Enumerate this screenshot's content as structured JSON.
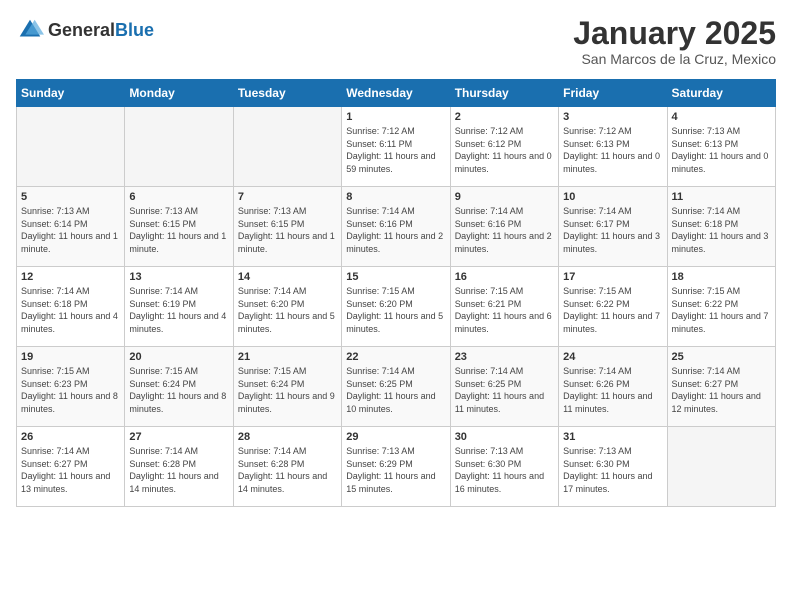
{
  "logo": {
    "general": "General",
    "blue": "Blue"
  },
  "header": {
    "month": "January 2025",
    "location": "San Marcos de la Cruz, Mexico"
  },
  "weekdays": [
    "Sunday",
    "Monday",
    "Tuesday",
    "Wednesday",
    "Thursday",
    "Friday",
    "Saturday"
  ],
  "weeks": [
    [
      {
        "day": "",
        "empty": true
      },
      {
        "day": "",
        "empty": true
      },
      {
        "day": "",
        "empty": true
      },
      {
        "day": "1",
        "sunrise": "Sunrise: 7:12 AM",
        "sunset": "Sunset: 6:11 PM",
        "daylight": "Daylight: 11 hours and 59 minutes."
      },
      {
        "day": "2",
        "sunrise": "Sunrise: 7:12 AM",
        "sunset": "Sunset: 6:12 PM",
        "daylight": "Daylight: 11 hours and 0 minutes."
      },
      {
        "day": "3",
        "sunrise": "Sunrise: 7:12 AM",
        "sunset": "Sunset: 6:13 PM",
        "daylight": "Daylight: 11 hours and 0 minutes."
      },
      {
        "day": "4",
        "sunrise": "Sunrise: 7:13 AM",
        "sunset": "Sunset: 6:13 PM",
        "daylight": "Daylight: 11 hours and 0 minutes."
      }
    ],
    [
      {
        "day": "5",
        "sunrise": "Sunrise: 7:13 AM",
        "sunset": "Sunset: 6:14 PM",
        "daylight": "Daylight: 11 hours and 1 minute."
      },
      {
        "day": "6",
        "sunrise": "Sunrise: 7:13 AM",
        "sunset": "Sunset: 6:15 PM",
        "daylight": "Daylight: 11 hours and 1 minute."
      },
      {
        "day": "7",
        "sunrise": "Sunrise: 7:13 AM",
        "sunset": "Sunset: 6:15 PM",
        "daylight": "Daylight: 11 hours and 1 minute."
      },
      {
        "day": "8",
        "sunrise": "Sunrise: 7:14 AM",
        "sunset": "Sunset: 6:16 PM",
        "daylight": "Daylight: 11 hours and 2 minutes."
      },
      {
        "day": "9",
        "sunrise": "Sunrise: 7:14 AM",
        "sunset": "Sunset: 6:16 PM",
        "daylight": "Daylight: 11 hours and 2 minutes."
      },
      {
        "day": "10",
        "sunrise": "Sunrise: 7:14 AM",
        "sunset": "Sunset: 6:17 PM",
        "daylight": "Daylight: 11 hours and 3 minutes."
      },
      {
        "day": "11",
        "sunrise": "Sunrise: 7:14 AM",
        "sunset": "Sunset: 6:18 PM",
        "daylight": "Daylight: 11 hours and 3 minutes."
      }
    ],
    [
      {
        "day": "12",
        "sunrise": "Sunrise: 7:14 AM",
        "sunset": "Sunset: 6:18 PM",
        "daylight": "Daylight: 11 hours and 4 minutes."
      },
      {
        "day": "13",
        "sunrise": "Sunrise: 7:14 AM",
        "sunset": "Sunset: 6:19 PM",
        "daylight": "Daylight: 11 hours and 4 minutes."
      },
      {
        "day": "14",
        "sunrise": "Sunrise: 7:14 AM",
        "sunset": "Sunset: 6:20 PM",
        "daylight": "Daylight: 11 hours and 5 minutes."
      },
      {
        "day": "15",
        "sunrise": "Sunrise: 7:15 AM",
        "sunset": "Sunset: 6:20 PM",
        "daylight": "Daylight: 11 hours and 5 minutes."
      },
      {
        "day": "16",
        "sunrise": "Sunrise: 7:15 AM",
        "sunset": "Sunset: 6:21 PM",
        "daylight": "Daylight: 11 hours and 6 minutes."
      },
      {
        "day": "17",
        "sunrise": "Sunrise: 7:15 AM",
        "sunset": "Sunset: 6:22 PM",
        "daylight": "Daylight: 11 hours and 7 minutes."
      },
      {
        "day": "18",
        "sunrise": "Sunrise: 7:15 AM",
        "sunset": "Sunset: 6:22 PM",
        "daylight": "Daylight: 11 hours and 7 minutes."
      }
    ],
    [
      {
        "day": "19",
        "sunrise": "Sunrise: 7:15 AM",
        "sunset": "Sunset: 6:23 PM",
        "daylight": "Daylight: 11 hours and 8 minutes."
      },
      {
        "day": "20",
        "sunrise": "Sunrise: 7:15 AM",
        "sunset": "Sunset: 6:24 PM",
        "daylight": "Daylight: 11 hours and 8 minutes."
      },
      {
        "day": "21",
        "sunrise": "Sunrise: 7:15 AM",
        "sunset": "Sunset: 6:24 PM",
        "daylight": "Daylight: 11 hours and 9 minutes."
      },
      {
        "day": "22",
        "sunrise": "Sunrise: 7:14 AM",
        "sunset": "Sunset: 6:25 PM",
        "daylight": "Daylight: 11 hours and 10 minutes."
      },
      {
        "day": "23",
        "sunrise": "Sunrise: 7:14 AM",
        "sunset": "Sunset: 6:25 PM",
        "daylight": "Daylight: 11 hours and 11 minutes."
      },
      {
        "day": "24",
        "sunrise": "Sunrise: 7:14 AM",
        "sunset": "Sunset: 6:26 PM",
        "daylight": "Daylight: 11 hours and 11 minutes."
      },
      {
        "day": "25",
        "sunrise": "Sunrise: 7:14 AM",
        "sunset": "Sunset: 6:27 PM",
        "daylight": "Daylight: 11 hours and 12 minutes."
      }
    ],
    [
      {
        "day": "26",
        "sunrise": "Sunrise: 7:14 AM",
        "sunset": "Sunset: 6:27 PM",
        "daylight": "Daylight: 11 hours and 13 minutes."
      },
      {
        "day": "27",
        "sunrise": "Sunrise: 7:14 AM",
        "sunset": "Sunset: 6:28 PM",
        "daylight": "Daylight: 11 hours and 14 minutes."
      },
      {
        "day": "28",
        "sunrise": "Sunrise: 7:14 AM",
        "sunset": "Sunset: 6:28 PM",
        "daylight": "Daylight: 11 hours and 14 minutes."
      },
      {
        "day": "29",
        "sunrise": "Sunrise: 7:13 AM",
        "sunset": "Sunset: 6:29 PM",
        "daylight": "Daylight: 11 hours and 15 minutes."
      },
      {
        "day": "30",
        "sunrise": "Sunrise: 7:13 AM",
        "sunset": "Sunset: 6:30 PM",
        "daylight": "Daylight: 11 hours and 16 minutes."
      },
      {
        "day": "31",
        "sunrise": "Sunrise: 7:13 AM",
        "sunset": "Sunset: 6:30 PM",
        "daylight": "Daylight: 11 hours and 17 minutes."
      },
      {
        "day": "",
        "empty": true
      }
    ]
  ]
}
